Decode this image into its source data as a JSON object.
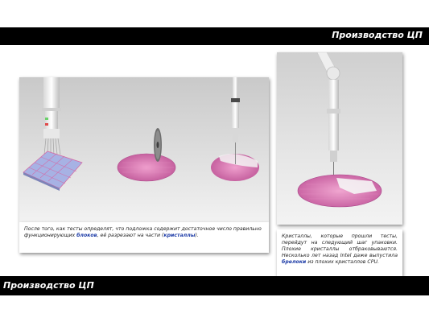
{
  "header": {
    "title": "Производство ЦП"
  },
  "footer": {
    "title": "Производство ЦП"
  },
  "left_caption": {
    "part1": "После того, как тесты определят, что подложка содержит достаточное число правильно функционирующих ",
    "highlight1": "блоков",
    "part2": ", её разрезают на части (",
    "highlight2": "кристаллы",
    "part3": ")."
  },
  "right_caption": {
    "part1": "Кристаллы, которые прошли тесты, перейдут на следующий шаг упаковки. Плохие кристаллы отбраковываются. Несколько лет назад Intel даже выпустила ",
    "highlight1": "брелоки",
    "part2": " из плохих кристаллов CPU."
  },
  "colors": {
    "wafer": "#d97eb6",
    "bar": "#000000",
    "highlight": "#1b3aa6"
  }
}
